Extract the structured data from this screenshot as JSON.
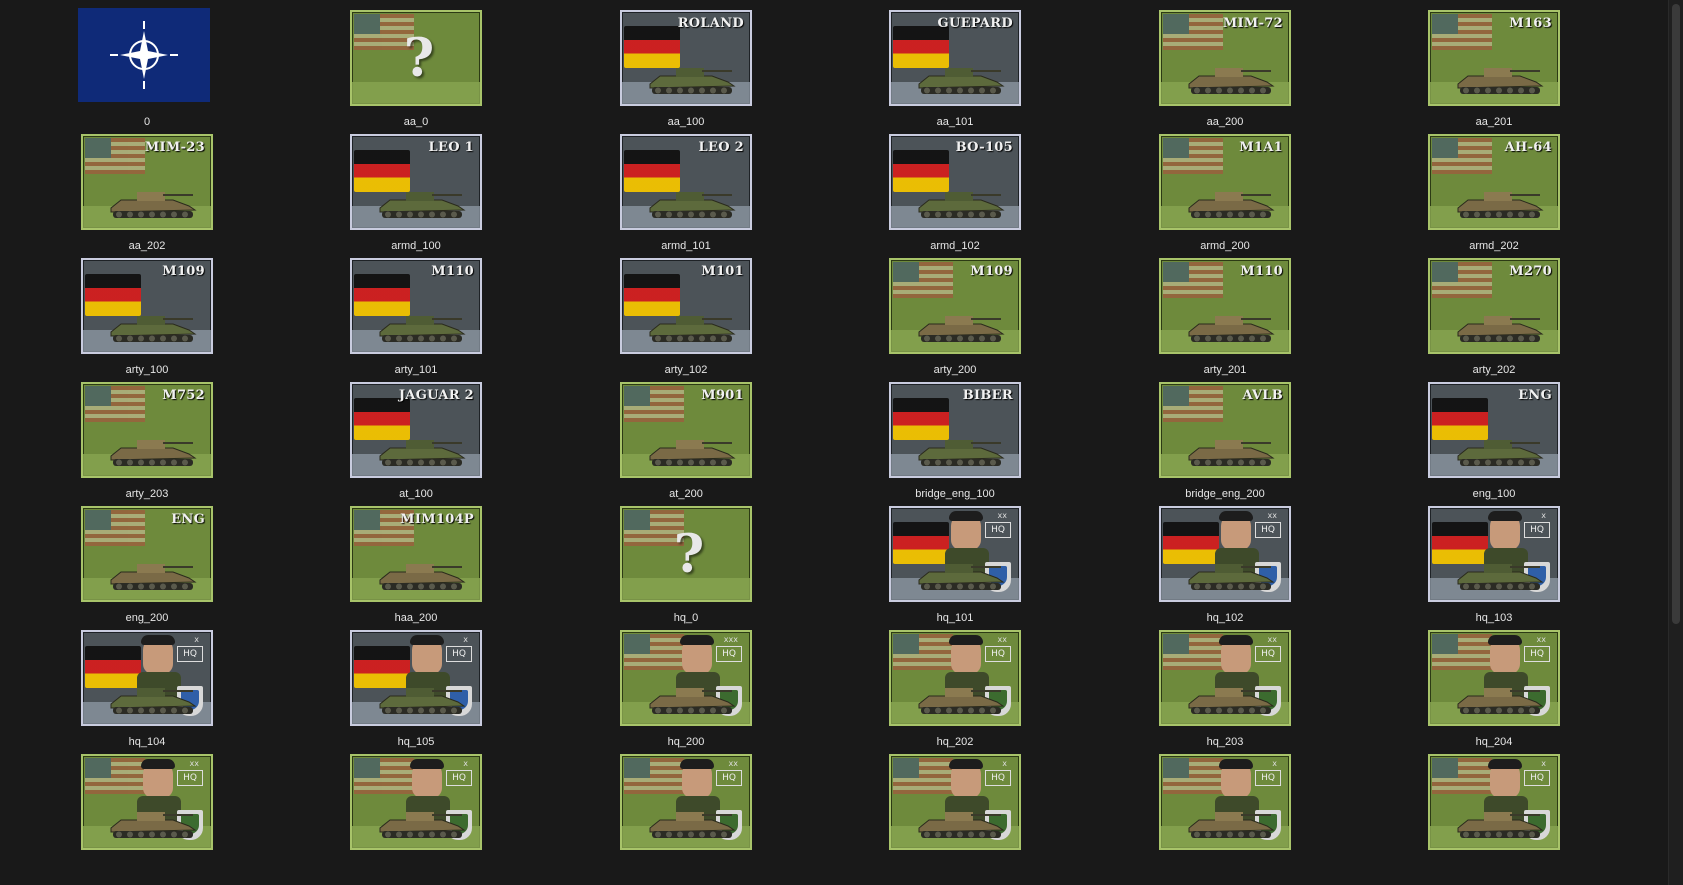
{
  "window": {
    "background": "#191919"
  },
  "colors": {
    "us_card": "#6e8a3c",
    "de_card": "#4c5358",
    "nato_blue": "#0f2a78"
  },
  "items": [
    {
      "name": "0",
      "kind": "nato",
      "label": ""
    },
    {
      "name": "aa_0",
      "kind": "us",
      "label": "",
      "question": "?"
    },
    {
      "name": "aa_100",
      "kind": "de",
      "label": "ROLAND"
    },
    {
      "name": "aa_101",
      "kind": "de",
      "label": "GUEPARD"
    },
    {
      "name": "aa_200",
      "kind": "us",
      "label": "MIM-72"
    },
    {
      "name": "aa_201",
      "kind": "us",
      "label": "M163"
    },
    {
      "name": "aa_202",
      "kind": "us",
      "label": "MIM-23"
    },
    {
      "name": "armd_100",
      "kind": "de",
      "label": "LEO 1"
    },
    {
      "name": "armd_101",
      "kind": "de",
      "label": "LEO 2"
    },
    {
      "name": "armd_102",
      "kind": "de",
      "label": "BO-105"
    },
    {
      "name": "armd_200",
      "kind": "us",
      "label": "M1A1"
    },
    {
      "name": "armd_202",
      "kind": "us",
      "label": "AH-64"
    },
    {
      "name": "arty_100",
      "kind": "de",
      "label": "M109"
    },
    {
      "name": "arty_101",
      "kind": "de",
      "label": "M110"
    },
    {
      "name": "arty_102",
      "kind": "de",
      "label": "M101"
    },
    {
      "name": "arty_200",
      "kind": "us",
      "label": "M109"
    },
    {
      "name": "arty_201",
      "kind": "us",
      "label": "M110"
    },
    {
      "name": "arty_202",
      "kind": "us",
      "label": "M270"
    },
    {
      "name": "arty_203",
      "kind": "us",
      "label": "M752"
    },
    {
      "name": "at_100",
      "kind": "de",
      "label": "JAGUAR 2"
    },
    {
      "name": "at_200",
      "kind": "us",
      "label": "M901"
    },
    {
      "name": "bridge_eng_100",
      "kind": "de",
      "label": "BIBER"
    },
    {
      "name": "bridge_eng_200",
      "kind": "us",
      "label": "AVLB"
    },
    {
      "name": "eng_100",
      "kind": "de",
      "label": "ENG"
    },
    {
      "name": "eng_200",
      "kind": "us",
      "label": "ENG"
    },
    {
      "name": "haa_200",
      "kind": "us",
      "label": "MIM104P"
    },
    {
      "name": "hq_0",
      "kind": "us",
      "label": "",
      "question": "?"
    },
    {
      "name": "hq_101",
      "kind": "de-hq",
      "label": "",
      "hq": "HQ",
      "rank": "xx"
    },
    {
      "name": "hq_102",
      "kind": "de-hq",
      "label": "",
      "hq": "HQ",
      "rank": "xx"
    },
    {
      "name": "hq_103",
      "kind": "de-hq",
      "label": "",
      "hq": "HQ",
      "rank": "x"
    },
    {
      "name": "hq_104",
      "kind": "de-hq",
      "label": "",
      "hq": "HQ",
      "rank": "x"
    },
    {
      "name": "hq_105",
      "kind": "de-hq",
      "label": "",
      "hq": "HQ",
      "rank": "x"
    },
    {
      "name": "hq_200",
      "kind": "us-hq",
      "label": "",
      "hq": "HQ",
      "rank": "xxx"
    },
    {
      "name": "hq_202",
      "kind": "us-hq",
      "label": "",
      "hq": "HQ",
      "rank": "xx"
    },
    {
      "name": "hq_203",
      "kind": "us-hq",
      "label": "",
      "hq": "HQ",
      "rank": "xx"
    },
    {
      "name": "hq_204",
      "kind": "us-hq",
      "label": "",
      "hq": "HQ",
      "rank": "xx"
    },
    {
      "name": "",
      "kind": "us-hq",
      "label": "",
      "hq": "HQ",
      "rank": "xx"
    },
    {
      "name": "",
      "kind": "us-hq",
      "label": "",
      "hq": "HQ",
      "rank": "x"
    },
    {
      "name": "",
      "kind": "us-hq",
      "label": "",
      "hq": "HQ",
      "rank": "xx"
    },
    {
      "name": "",
      "kind": "us-hq",
      "label": "",
      "hq": "HQ",
      "rank": "x"
    },
    {
      "name": "",
      "kind": "us-hq",
      "label": "",
      "hq": "HQ",
      "rank": "x"
    },
    {
      "name": "",
      "kind": "us-hq",
      "label": "",
      "hq": "HQ",
      "rank": "x"
    }
  ]
}
